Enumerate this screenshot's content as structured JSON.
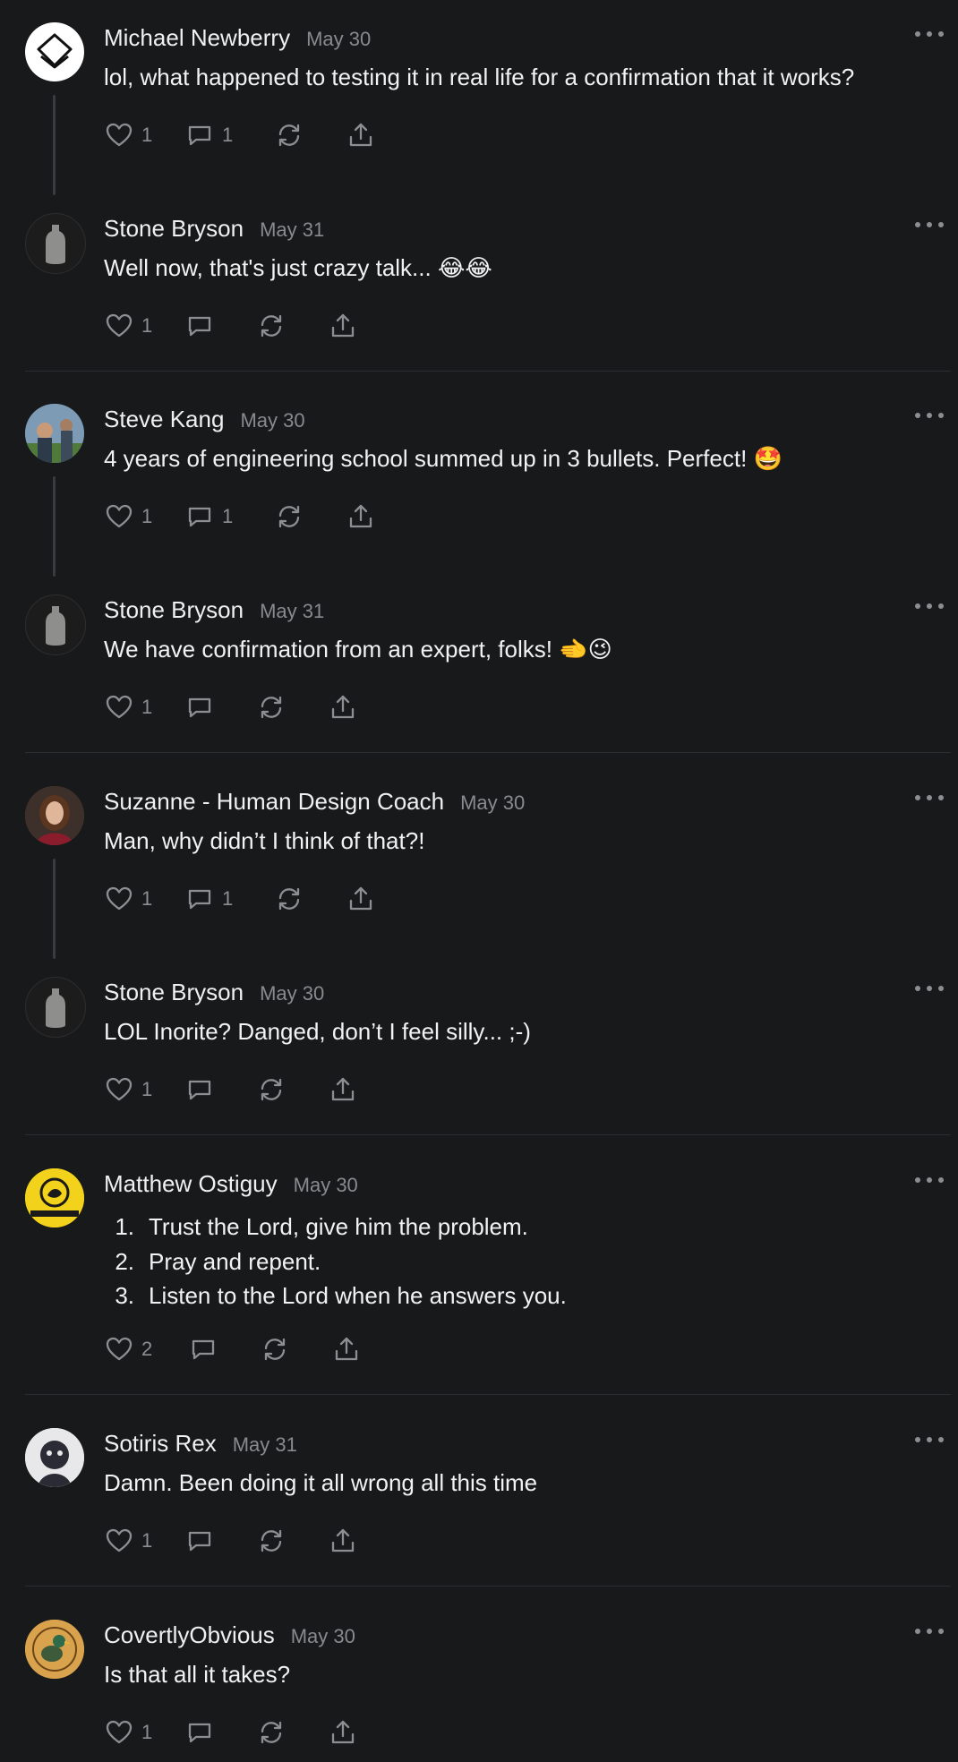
{
  "comments": [
    {
      "name": "Michael Newberry",
      "date": "May 30",
      "text": "lol, what happened to testing it in real life for a confirmation that it works?",
      "likes": "1",
      "replies": "1"
    },
    {
      "name": "Stone Bryson",
      "date": "May 31",
      "text": "Well now, that's just crazy talk...",
      "emoji": "😂😂",
      "likes": "1",
      "replies": ""
    },
    {
      "name": "Steve Kang",
      "date": "May 30",
      "text": "4 years of engineering school summed up in 3 bullets. Perfect!",
      "emoji": "🤩",
      "likes": "1",
      "replies": "1"
    },
    {
      "name": "Stone Bryson",
      "date": "May 31",
      "text": "We have confirmation from an expert, folks!",
      "emoji": "🫲😉",
      "likes": "1",
      "replies": ""
    },
    {
      "name": "Suzanne - Human Design Coach",
      "date": "May 30",
      "text": "Man, why didn’t I think of that?!",
      "likes": "1",
      "replies": "1"
    },
    {
      "name": "Stone Bryson",
      "date": "May 30",
      "text": "LOL Inorite? Danged, don’t I feel silly... ;-)",
      "likes": "1",
      "replies": ""
    },
    {
      "name": "Matthew Ostiguy",
      "date": "May 30",
      "list": [
        "Trust the Lord, give him the problem.",
        "Pray and repent.",
        "Listen to the Lord when he answers you."
      ],
      "list_numbers": [
        "1.",
        "2.",
        "3."
      ],
      "likes": "2",
      "replies": ""
    },
    {
      "name": "Sotiris Rex",
      "date": "May 31",
      "text": "Damn. Been doing it all wrong all this time",
      "likes": "1",
      "replies": ""
    },
    {
      "name": "CovertlyObvious",
      "date": "May 30",
      "text": "Is that all it takes?",
      "likes": "1",
      "replies": ""
    }
  ],
  "colors": {
    "background": "#18191b",
    "text": "#ebebeb",
    "muted": "#8a8a8e",
    "divider": "#2c2d30"
  }
}
